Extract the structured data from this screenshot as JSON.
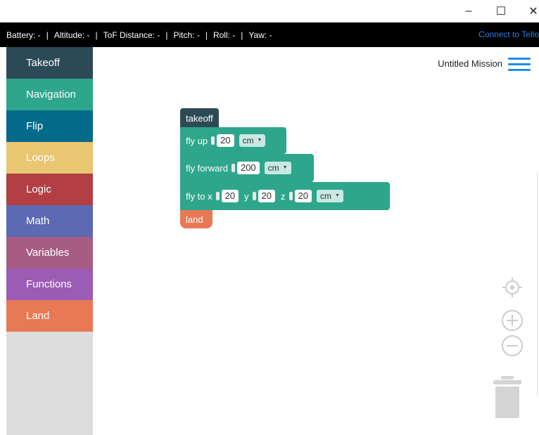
{
  "window": {
    "controls": [
      "–",
      "☐",
      "✕"
    ]
  },
  "status": {
    "battery": "Battery: -",
    "altitude": "Altitude: -",
    "tof": "ToF Distance: -",
    "pitch": "Pitch: -",
    "roll": "Roll: -",
    "yaw": "Yaw: -",
    "separator": "|",
    "connect": "Connect to Tello"
  },
  "sidebar": {
    "categories": [
      {
        "label": "Takeoff",
        "color": "#2c4a56"
      },
      {
        "label": "Navigation",
        "color": "#2ea68c"
      },
      {
        "label": "Flip",
        "color": "#036a8c"
      },
      {
        "label": "Loops",
        "color": "#e9c670"
      },
      {
        "label": "Logic",
        "color": "#b13f44"
      },
      {
        "label": "Math",
        "color": "#5b6ab1"
      },
      {
        "label": "Variables",
        "color": "#a65c83"
      },
      {
        "label": "Functions",
        "color": "#9a5cb4"
      },
      {
        "label": "Land",
        "color": "#e87955"
      }
    ]
  },
  "workspace": {
    "mission_title": "Untitled Mission",
    "blocks": {
      "takeoff": {
        "label": "takeoff",
        "color": "#2c4a56"
      },
      "fly_up": {
        "label": "fly up",
        "value": "20",
        "unit": "cm",
        "color": "#2ea68c"
      },
      "fly_forward": {
        "label": "fly forward",
        "value": "200",
        "unit": "cm",
        "color": "#2ea68c"
      },
      "fly_to": {
        "label": "fly to x",
        "x": "20",
        "y_label": "y",
        "y": "20",
        "z_label": "z",
        "z": "20",
        "unit": "cm",
        "color": "#2ea68c"
      },
      "land": {
        "label": "land",
        "color": "#e87955"
      }
    }
  },
  "icons": {
    "menu": "hamburger-menu-icon",
    "recenter": "crosshair-icon",
    "zoom_in": "zoom-in-icon",
    "zoom_out": "zoom-out-icon",
    "trash": "trash-icon"
  }
}
